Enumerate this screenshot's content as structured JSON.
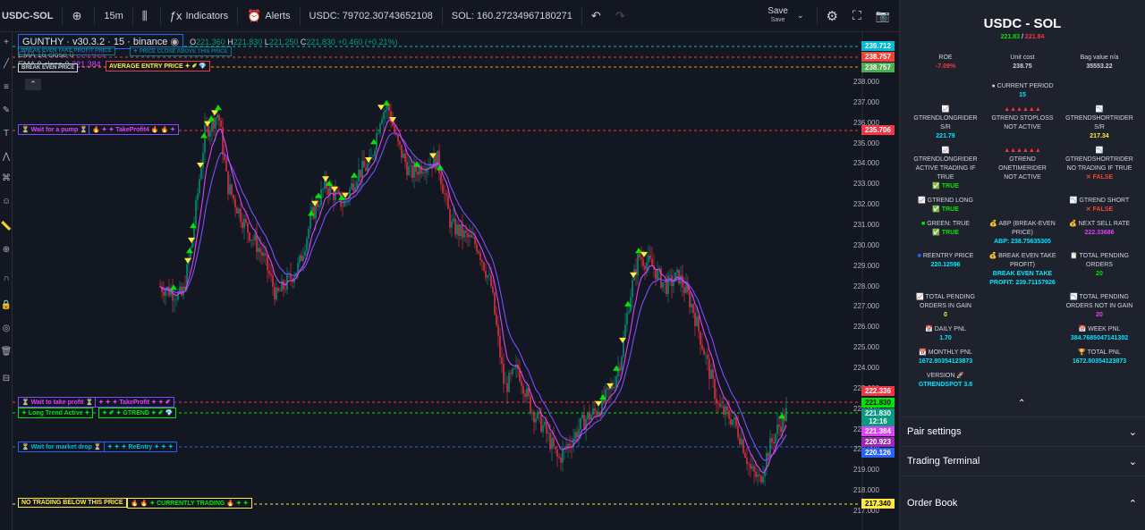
{
  "toolbar": {
    "symbol": "USDC-SOL",
    "add_symbol_icon": "plus-circle-icon",
    "interval": "15m",
    "chart_type_icon": "candles-icon",
    "indicators_label": "Indicators",
    "alerts_label": "Alerts",
    "usdc_balance": "USDC: 79702.30743652108",
    "sol_balance": "SOL: 160.27234967180271",
    "save_label": "Save",
    "save_sub": "Save"
  },
  "legend": {
    "title": "GUNTHY · v30.3.2 · 15 · binance",
    "ohlc_o_label": "O",
    "ohlc_o": "221.360",
    "ohlc_h_label": "H",
    "ohlc_h": "221.830",
    "ohlc_l_label": "L",
    "ohlc_l": "221.250",
    "ohlc_c_label": "C",
    "ohlc_c": "221.830",
    "ohlc_change": "+0.460 (+0.21%)",
    "ema1_label": "EMA",
    "ema1_params": "16 close 0",
    "ema1_value": "220.923",
    "ema2_label": "EMA",
    "ema2_params": "8 close 0",
    "ema2_value": "221.384",
    "collapse_icon": "chevron-up-icon"
  },
  "chart_labels": {
    "break_even": "BREAK EVEN TAKE PROFIT PRICE",
    "break_even_info": "✦ PRICE CLOSE ABOVE THIS PRICE",
    "break_even_price_label": "BREAK EVEN PRICE",
    "average_entry": "AVERAGE ENTRY PRICE ✦ ✐ 💎",
    "wait_pump": "⏳ Wait for a pump ⏳",
    "take_profit4": "🔥 ✦ ✦ TakeProfit4 🔥 🔥 ✦",
    "wait_take_profit": "⏳ Wait to take profit ⏳",
    "take_profit": "✦ ✦ ✦ TakeProfit ✦ ✦ ✐",
    "long_trend": "✦ Long Trend Active ✦",
    "gtrend": "✦ ✐ ✦ GTREND ✦ ✐ 💎",
    "wait_market_drop": "⏳ Wait for market drop ⏳",
    "reentry": "✦ ✦ ✦ ReEntry ✦ ✦ ✦",
    "no_trading": "NO TRADING BELOW THIS PRICE",
    "currently_trading": "🔥 🔥 ✦ CURRENTLY TRADING 🔥 ✦ ✦"
  },
  "price_axis": {
    "ticks": [
      "238.000",
      "237.000",
      "236.000",
      "235.000",
      "234.000",
      "233.000",
      "232.000",
      "231.000",
      "230.000",
      "229.000",
      "228.000",
      "227.000",
      "226.000",
      "225.000",
      "224.000",
      "223.000",
      "222.000",
      "221.000",
      "220.000",
      "219.000",
      "218.000",
      "217.000"
    ],
    "tags": [
      {
        "value": "239.712",
        "color": "#00bcd4"
      },
      {
        "value": "238.757",
        "color": "#f44336"
      },
      {
        "value": "238.757",
        "color": "#4caf50"
      },
      {
        "value": "235.706",
        "color": "#f23645"
      },
      {
        "value": "222.336",
        "color": "#f23645"
      },
      {
        "value": "221.830",
        "color": "#00e600"
      },
      {
        "value": "221.830",
        "color": "#089981"
      },
      {
        "value": "12:16",
        "color": "#089981"
      },
      {
        "value": "221.384",
        "color": "#e040fb"
      },
      {
        "value": "220.923",
        "color": "#9c27b0"
      },
      {
        "value": "220.126",
        "color": "#2962ff"
      },
      {
        "value": "217.340",
        "color": "#ffeb3b"
      }
    ]
  },
  "panel": {
    "pair": "USDC - SOL",
    "price_green": "221.83",
    "price_sep": " / ",
    "price_red": "221.84",
    "roe_label": "ROE",
    "roe_value": "-7.09%",
    "unit_cost_label": "Unit cost",
    "unit_cost_value": "238.75",
    "bag_value_label": "Bag value n/a",
    "bag_value_value": "35553.22",
    "current_period_label": "CURRENT PERIOD",
    "current_period_value": "15",
    "glr_sr_label": "GTRENDLONGRIDER S/R",
    "glr_sr_value": "221.79",
    "stoploss_label": "GTREND STOPLOSS",
    "stoploss_value": "NOT ACTIVE",
    "gsr_sr_label": "GTRENDSHORTRIDER S/R",
    "gsr_sr_value": "217.34",
    "glr_active_label": "GTRENDLONGRIDER ACTIVE TRADING IF TRUE",
    "glr_active_value": "✅ TRUE",
    "onetime_label": "GTREND ONETIMERIDER",
    "onetime_value": "NOT ACTIVE",
    "gsr_no_label": "GTRENDSHORTRIDER NO TRADING IF TRUE",
    "gsr_no_value": "✕ FALSE",
    "gtrend_long_label": "GTREND LONG",
    "gtrend_long_value": "✅ TRUE",
    "gtrend_short_label": "GTREND SHORT",
    "gtrend_short_value": "✕ FALSE",
    "green_label": "GREEN: TRUE",
    "green_value": "✅ TRUE",
    "abp_label": "ABP (BREAK-EVEN PRICE)",
    "abp_value": "ABP: 238.75635305",
    "next_sell_label": "NEXT SELL RATE",
    "next_sell_value": "222.33686",
    "reentry_label": "REENTRY PRICE",
    "reentry_value": "220.12596",
    "betp_label": "BREAK EVEN TAKE PROFIT)",
    "betp_value": "BREAK EVEN TAKE PROFIT: 239.71157926",
    "pending_label": "TOTAL PENDING ORDERS",
    "pending_value": "20",
    "pending_gain_label": "TOTAL PENDING ORDERS IN GAIN",
    "pending_gain_value": "0",
    "pending_notgain_label": "TOTAL PENDING ORDERS NOT IN GAIN",
    "pending_notgain_value": "20",
    "daily_pnl_label": "DAILY PNL",
    "daily_pnl_value": "1.70",
    "week_pnl_label": "WEEK PNL",
    "week_pnl_value": "384.7685047141302",
    "monthly_pnl_label": "MONTHLY PNL",
    "monthly_pnl_value": "1672.80354123873",
    "total_pnl_label": "TOTAL PNL",
    "total_pnl_value": "1672.80354123873",
    "version_label": "VERSION",
    "version_value": "GTRENDSPOT 3.8",
    "sections": [
      "Pair settings",
      "Trading Terminal",
      "Order Book"
    ]
  },
  "colors": {
    "bg": "#131722",
    "panel_bg": "#1e222d",
    "bull": "#089981",
    "bear": "#f23645",
    "ema_fast": "#e040fb",
    "ema_slow": "#7c4dff",
    "true_green": "#00e600",
    "false_red": "#f44336",
    "value_cyan": "#00e5ff",
    "value_magenta": "#e040fb",
    "value_yellow": "#ffeb3b"
  }
}
